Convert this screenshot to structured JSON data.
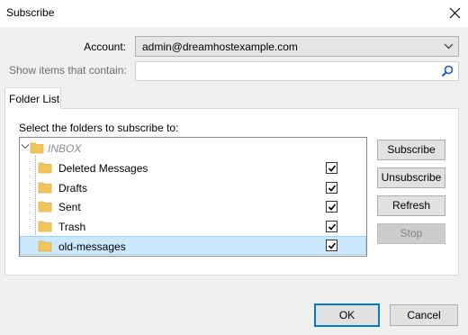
{
  "window": {
    "title": "Subscribe"
  },
  "account": {
    "label": "Account:",
    "value": "admin@dreamhostexample.com"
  },
  "filter": {
    "label": "Show items that contain:",
    "value": ""
  },
  "tab": {
    "label": "Folder List"
  },
  "folders_label": "Select the folders to subscribe to:",
  "tree": {
    "root": "INBOX",
    "items": [
      {
        "name": "Deleted Messages",
        "checked": true
      },
      {
        "name": "Drafts",
        "checked": true
      },
      {
        "name": "Sent",
        "checked": true
      },
      {
        "name": "Trash",
        "checked": true
      },
      {
        "name": "old-messages",
        "checked": true,
        "selected": true
      }
    ]
  },
  "side_buttons": {
    "subscribe": "Subscribe",
    "unsubscribe": "Unsubscribe",
    "refresh": "Refresh",
    "stop": "Stop"
  },
  "footer_buttons": {
    "ok": "OK",
    "cancel": "Cancel"
  },
  "colors": {
    "selection": "#cce8ff",
    "selection_border": "#99d1ff",
    "focus": "#0078d7",
    "folder": "#f2c55c"
  },
  "icons": {
    "close": "close-icon",
    "dropdown": "chevron-down-icon",
    "search": "search-icon",
    "folder": "folder-icon",
    "check": "checkmark-icon"
  }
}
